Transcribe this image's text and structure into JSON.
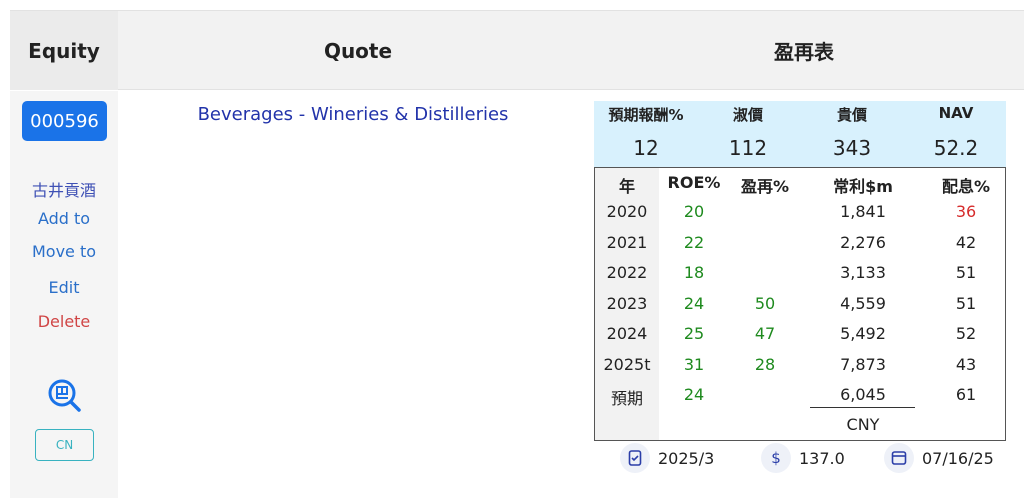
{
  "header": {
    "equity": "Equity",
    "quote": "Quote",
    "table_title": "盈再表"
  },
  "left": {
    "code": "000596",
    "name": "古井貢酒",
    "add_to": "Add to",
    "move_to": "Move to",
    "edit": "Edit",
    "delete": "Delete",
    "market": "CN"
  },
  "quote": {
    "industry": "Beverages - Wineries & Distilleries"
  },
  "valuation": {
    "labels": [
      "預期報酬%",
      "淑價",
      "貴價",
      "NAV"
    ],
    "values": [
      "12",
      "112",
      "343",
      "52.2"
    ]
  },
  "table": {
    "headers": [
      "年",
      "ROE%",
      "盈再%",
      "常利$m",
      "配息%"
    ],
    "rows": [
      [
        "2020",
        "20",
        "",
        "1,841",
        "36"
      ],
      [
        "2021",
        "22",
        "",
        "2,276",
        "42"
      ],
      [
        "2022",
        "18",
        "",
        "3,133",
        "51"
      ],
      [
        "2023",
        "24",
        "50",
        "4,559",
        "51"
      ],
      [
        "2024",
        "25",
        "47",
        "5,492",
        "52"
      ],
      [
        "2025t",
        "31",
        "28",
        "7,873",
        "43"
      ],
      [
        "預期",
        "24",
        "",
        "6,045",
        "61"
      ]
    ],
    "currency": "CNY"
  },
  "footer": {
    "period": "2025/3",
    "price": "137.0",
    "date": "07/16/25"
  },
  "colors": {
    "accent": "#1a73e8",
    "green": "#1e8a1e",
    "red": "#d62b2b",
    "valuation_bg": "#d8f1fd"
  }
}
